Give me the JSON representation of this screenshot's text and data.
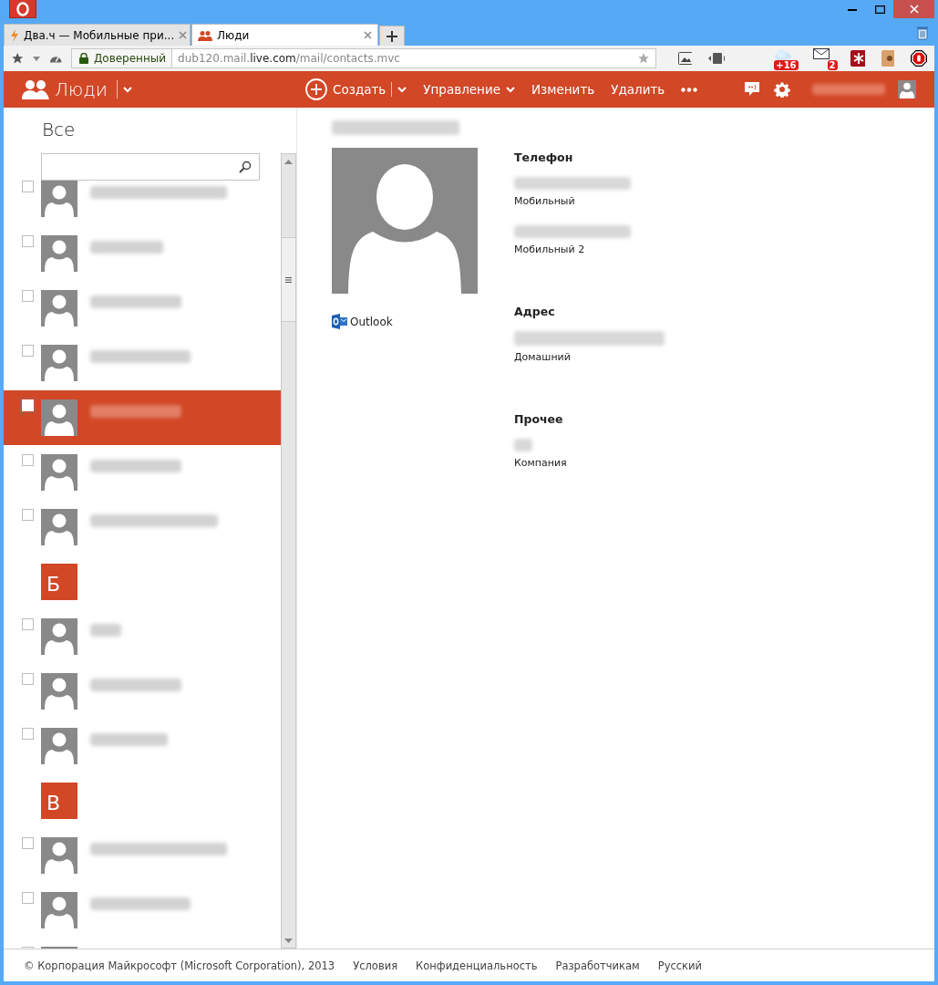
{
  "browser": {
    "tabs": [
      {
        "title": "Два.ч — Мобильные при...",
        "selected": false
      },
      {
        "title": "Люди",
        "selected": true
      }
    ],
    "security_label": "Доверенный",
    "url": {
      "host_prefix": "dub120.mail.",
      "host": "live.com",
      "path": "/mail/contacts.mvc"
    },
    "extension_badges": [
      "+16",
      "2"
    ]
  },
  "app_bar": {
    "title": "Люди",
    "commands": [
      {
        "label": "Создать",
        "kind": "create"
      },
      {
        "label": "Управление",
        "kind": "menu"
      },
      {
        "label": "Изменить",
        "kind": "plain"
      },
      {
        "label": "Удалить",
        "kind": "plain"
      }
    ]
  },
  "list": {
    "heading": "Все",
    "items": [
      {
        "kind": "contact",
        "checked": false,
        "selected": false
      },
      {
        "kind": "contact",
        "checked": false,
        "selected": false
      },
      {
        "kind": "contact",
        "checked": false,
        "selected": false
      },
      {
        "kind": "contact",
        "checked": false,
        "selected": false
      },
      {
        "kind": "contact",
        "checked": false,
        "selected": true
      },
      {
        "kind": "contact",
        "checked": false,
        "selected": false
      },
      {
        "kind": "contact",
        "checked": false,
        "selected": false
      },
      {
        "kind": "letter",
        "letter": "Б"
      },
      {
        "kind": "contact",
        "checked": false,
        "selected": false
      },
      {
        "kind": "contact",
        "checked": false,
        "selected": false
      },
      {
        "kind": "contact",
        "checked": false,
        "selected": false
      },
      {
        "kind": "letter",
        "letter": "В"
      },
      {
        "kind": "contact",
        "checked": false,
        "selected": false
      },
      {
        "kind": "contact",
        "checked": false,
        "selected": false
      },
      {
        "kind": "contact",
        "checked": false,
        "selected": false
      }
    ]
  },
  "contact": {
    "source": "Outlook",
    "sections": [
      {
        "heading": "Телефон",
        "fields": [
          {
            "label": "Мобильный"
          },
          {
            "label": "Мобильный 2"
          }
        ]
      },
      {
        "heading": "Адрес",
        "fields": [
          {
            "label": "Домашний"
          }
        ]
      },
      {
        "heading": "Прочее",
        "fields": [
          {
            "label": "Компания"
          }
        ]
      }
    ]
  },
  "footer": {
    "copyright": "© Корпорация Майкрософт (Microsoft Corporation), 2013",
    "links": [
      "Условия",
      "Конфиденциальность",
      "Разработчикам",
      "Русский"
    ]
  }
}
